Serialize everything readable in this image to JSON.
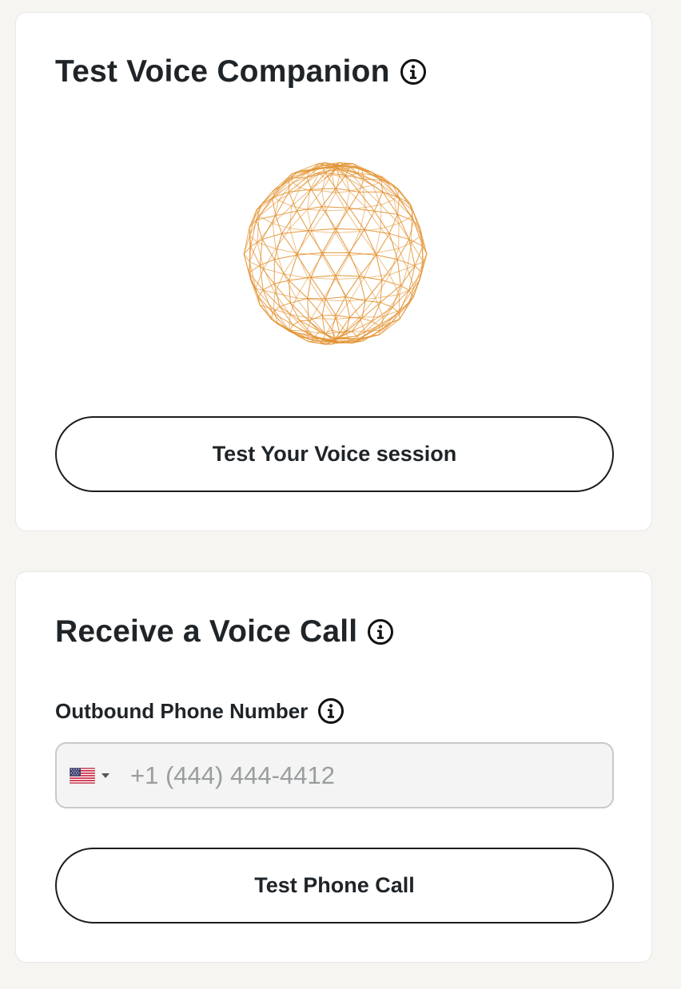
{
  "voice_companion": {
    "title": "Test Voice Companion",
    "info_icon": "info-circle-icon",
    "orb_icon": "wireframe-sphere",
    "orb_color": "#e39435",
    "button_label": "Test Your Voice session"
  },
  "voice_call": {
    "title": "Receive a Voice Call",
    "info_icon": "info-circle-icon",
    "phone_field": {
      "label": "Outbound Phone Number",
      "country_flag": "us-flag-icon",
      "placeholder": "+1 (444) 444-4412",
      "value": ""
    },
    "button_label": "Test Phone Call"
  },
  "colors": {
    "page_background": "#f6f5f2",
    "card_background": "#ffffff",
    "text": "#1f2428",
    "input_background": "#f3f4f3"
  }
}
